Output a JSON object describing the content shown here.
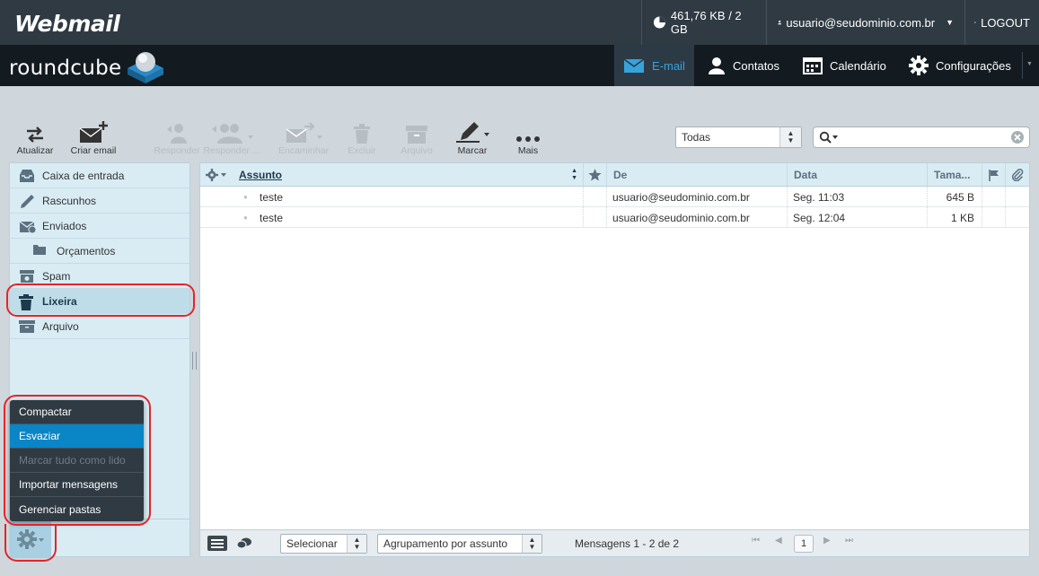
{
  "topbar": {
    "logo": "Webmail",
    "quota": "461,76 KB / 2 GB",
    "user": "usuario@seudominio.com.br",
    "logout": "LOGOUT"
  },
  "header": {
    "logo": "roundcube",
    "nav": [
      {
        "label": "E-mail",
        "icon": "envelope-icon",
        "active": true
      },
      {
        "label": "Contatos",
        "icon": "person-icon"
      },
      {
        "label": "Calendário",
        "icon": "calendar-icon"
      },
      {
        "label": "Configurações",
        "icon": "gear-icon"
      }
    ]
  },
  "toolbar": {
    "refresh": "Atualizar",
    "compose": "Criar email",
    "reply": "Responder",
    "reply_all": "Responder ...",
    "forward": "Encaminhar",
    "delete": "Excluir",
    "archive": "Arquivo",
    "mark": "Marcar",
    "more": "Mais",
    "filter_value": "Todas",
    "search_placeholder": ""
  },
  "folders": [
    {
      "label": "Caixa de entrada",
      "icon": "inbox-icon"
    },
    {
      "label": "Rascunhos",
      "icon": "pencil-icon"
    },
    {
      "label": "Enviados",
      "icon": "sent-icon"
    },
    {
      "label": "Orçamentos",
      "icon": "folder-icon",
      "sub": true
    },
    {
      "label": "Spam",
      "icon": "spam-icon"
    },
    {
      "label": "Lixeira",
      "icon": "trash-icon",
      "selected": true
    },
    {
      "label": "Arquivo",
      "icon": "archive-icon"
    }
  ],
  "folder_menu": [
    {
      "label": "Compactar"
    },
    {
      "label": "Esvaziar",
      "active": true
    },
    {
      "label": "Marcar tudo como lido",
      "disabled": true
    },
    {
      "label": "Importar mensagens"
    },
    {
      "label": "Gerenciar pastas"
    }
  ],
  "messages": {
    "columns": {
      "subject": "Assunto",
      "from": "De",
      "date": "Data",
      "size": "Tama..."
    },
    "rows": [
      {
        "subject": "teste",
        "from": "usuario@seudominio.com.br",
        "date": "Seg. 11:03",
        "size": "645 B"
      },
      {
        "subject": "teste",
        "from": "usuario@seudominio.com.br",
        "date": "Seg. 12:04",
        "size": "1 KB"
      }
    ]
  },
  "footer": {
    "select": "Selecionar",
    "threads": "Agrupamento por assunto",
    "count": "Mensagens 1 - 2 de 2",
    "page": "1"
  },
  "colors": {
    "accent": "#37a3dd",
    "highlight": "#e0262c",
    "menu_active": "#0a85c6"
  }
}
